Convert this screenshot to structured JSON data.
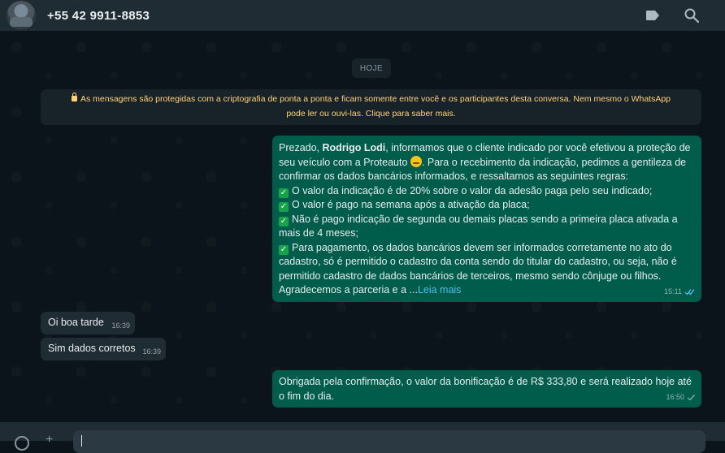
{
  "header": {
    "contact": "+55 42 9911-8853",
    "icons": [
      "avatar",
      "label-icon",
      "search-icon"
    ]
  },
  "chat": {
    "date_chip": "HOJE",
    "encryption_notice_line1": "As mensagens são protegidas com a criptografia de ponta a ponta e ficam somente entre você e os participantes desta conversa. Nem mesmo o WhatsApp",
    "encryption_notice_line2": "pode ler ou ouvi-las. Clique para saber mais."
  },
  "messages": {
    "m1": {
      "greeting": "Prezado, ",
      "name": "Rodrigo Lodi",
      "p1": ", informamos que o cliente indicado por você efetivou a proteção de seu veículo com a Proteauto ",
      "p2": ". Para o recebimento da indicação, pedimos a gentileza de confirmar os dados bancários informados, e ressaltamos as seguintes regras:",
      "rule1": "O valor da indicação é de 20% sobre o valor da adesão paga pelo seu indicado;",
      "rule2": "O valor é pago na semana após a ativação da placa;",
      "rule3": "Não é pago indicação de segunda ou demais placas sendo a primeira placa ativada a mais de 4 meses;",
      "rule4": "Para pagamento, os dados bancários devem ser informados corretamente no ato do cadastro, só é permitido o cadastro da conta sendo do titular do cadastro, ou seja, não é permitido cadastro de dados bancários de terceiros, mesmo sendo cônjuge ou filhos.",
      "closing": "Agradecemos a parceria e a ...",
      "read_more": "Leia mais",
      "time": "15:11",
      "status": "read"
    },
    "m2": {
      "text": "Oi boa tarde",
      "time": "16:39"
    },
    "m3": {
      "text": "Sim dados corretos",
      "time": "16:39"
    },
    "m4": {
      "text": "Obrigada pela confirmação, o valor da bonificação é de R$ 333,80 e será realizado hoje até o fim do dia.",
      "time": "16:50",
      "status": "sent"
    }
  },
  "colors": {
    "outgoing": "#005c4b",
    "incoming": "#202c33",
    "link": "#53bdeb",
    "notice": "#ffd279"
  }
}
